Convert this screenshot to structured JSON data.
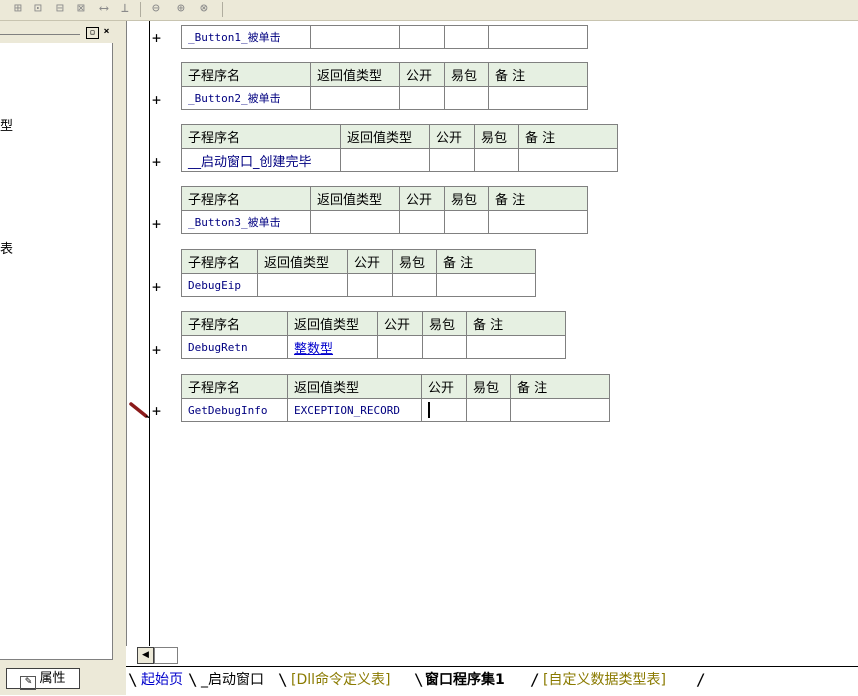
{
  "toolbar": {
    "icons": [
      "table-insert-icon",
      "table-align-icon",
      "table-merge-icon",
      "table-split-icon",
      "column-width-icon",
      "row-height-icon",
      "fit-width-icon",
      "fit-height-icon",
      "fit-all-icon"
    ]
  },
  "left_panel": {
    "truncated_labels": [
      "型",
      "表"
    ],
    "properties_tab": "属性"
  },
  "subroutines": [
    {
      "headers": null,
      "name": "_Button1_被单击",
      "return_type": "",
      "public": "",
      "easy_pack": "",
      "note": ""
    },
    {
      "headers": [
        "子程序名",
        "返回值类型",
        "公开",
        "易包",
        "备 注"
      ],
      "name": "_Button2_被单击",
      "return_type": "",
      "public": "",
      "easy_pack": "",
      "note": ""
    },
    {
      "headers": [
        "子程序名",
        "返回值类型",
        "公开",
        "易包",
        "备 注"
      ],
      "name": "__启动窗口_创建完毕",
      "return_type": "",
      "public": "",
      "easy_pack": "",
      "note": ""
    },
    {
      "headers": [
        "子程序名",
        "返回值类型",
        "公开",
        "易包",
        "备 注"
      ],
      "name": "_Button3_被单击",
      "return_type": "",
      "public": "",
      "easy_pack": "",
      "note": ""
    },
    {
      "headers": [
        "子程序名",
        "返回值类型",
        "公开",
        "易包",
        "备 注"
      ],
      "name": "DebugEip",
      "return_type": "",
      "public": "",
      "easy_pack": "",
      "note": ""
    },
    {
      "headers": [
        "子程序名",
        "返回值类型",
        "公开",
        "易包",
        "备 注"
      ],
      "name": "DebugRetn",
      "return_type": "整数型",
      "public": "",
      "easy_pack": "",
      "note": ""
    },
    {
      "headers": [
        "子程序名",
        "返回值类型",
        "公开",
        "易包",
        "备 注"
      ],
      "name": "GetDebugInfo",
      "return_type": "EXCEPTION_RECORD",
      "public": "",
      "easy_pack": "",
      "note": ""
    }
  ],
  "plus_symbol": "+",
  "bottom_tabs": [
    {
      "label": "起始页",
      "color": "#0000cc",
      "bold": false
    },
    {
      "label": "_启动窗口",
      "color": "#000000",
      "bold": false
    },
    {
      "label": "[Dll命令定义表]",
      "color": "#8a7a00",
      "bold": false
    },
    {
      "label": "窗口程序集1",
      "color": "#000000",
      "bold": true
    },
    {
      "label": "[自定义数据类型表]",
      "color": "#8a7a00",
      "bold": false
    }
  ],
  "colors": {
    "header_bg": "#e6f0e2",
    "name_text": "#000080",
    "type_link": "#0000cc",
    "chrome_bg": "#ece9d8"
  }
}
